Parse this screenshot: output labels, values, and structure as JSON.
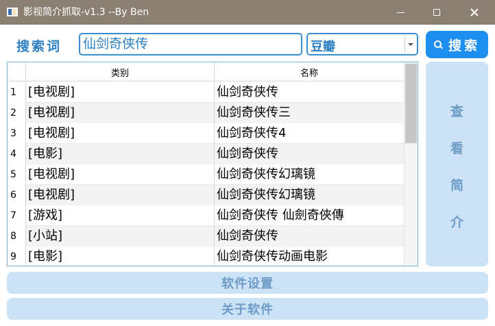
{
  "window": {
    "title": "影视简介抓取-v1.3 --By Ben",
    "icon": "app-window-icon"
  },
  "search": {
    "label": "搜索词",
    "query": "仙剑奇侠传",
    "source_selected": "豆瓣",
    "button_label": "搜索",
    "button_icon": "search-icon"
  },
  "table": {
    "columns": [
      "类别",
      "名称"
    ],
    "rows": [
      {
        "index": "1",
        "category": "[电视剧]",
        "name": "仙剑奇侠传"
      },
      {
        "index": "2",
        "category": "[电视剧]",
        "name": "仙剑奇侠传三"
      },
      {
        "index": "3",
        "category": "[电视剧]",
        "name": "仙剑奇侠传4"
      },
      {
        "index": "4",
        "category": "[电影]",
        "name": "仙剑奇侠传"
      },
      {
        "index": "5",
        "category": "[电视剧]",
        "name": "仙剑奇侠传幻璃镜"
      },
      {
        "index": "6",
        "category": "[电视剧]",
        "name": "仙剑奇侠传幻璃镜"
      },
      {
        "index": "7",
        "category": "[游戏]",
        "name": "仙剑奇侠传 仙劍奇俠傳"
      },
      {
        "index": "8",
        "category": "[小站]",
        "name": "仙剑奇侠传"
      },
      {
        "index": "9",
        "category": "[电影]",
        "name": "仙剑奇侠传动画电影"
      }
    ]
  },
  "side": {
    "view_chars": [
      "查",
      "看",
      "简",
      "介"
    ]
  },
  "bottom": {
    "settings_label": "软件设置",
    "about_label": "关于软件"
  },
  "colors": {
    "titlebar": "#8b8073",
    "accent": "#1e8ff0",
    "label_blue": "#2b7fc3",
    "disabled_button_bg": "#cce3f7",
    "disabled_button_text": "#6d9bc6"
  }
}
